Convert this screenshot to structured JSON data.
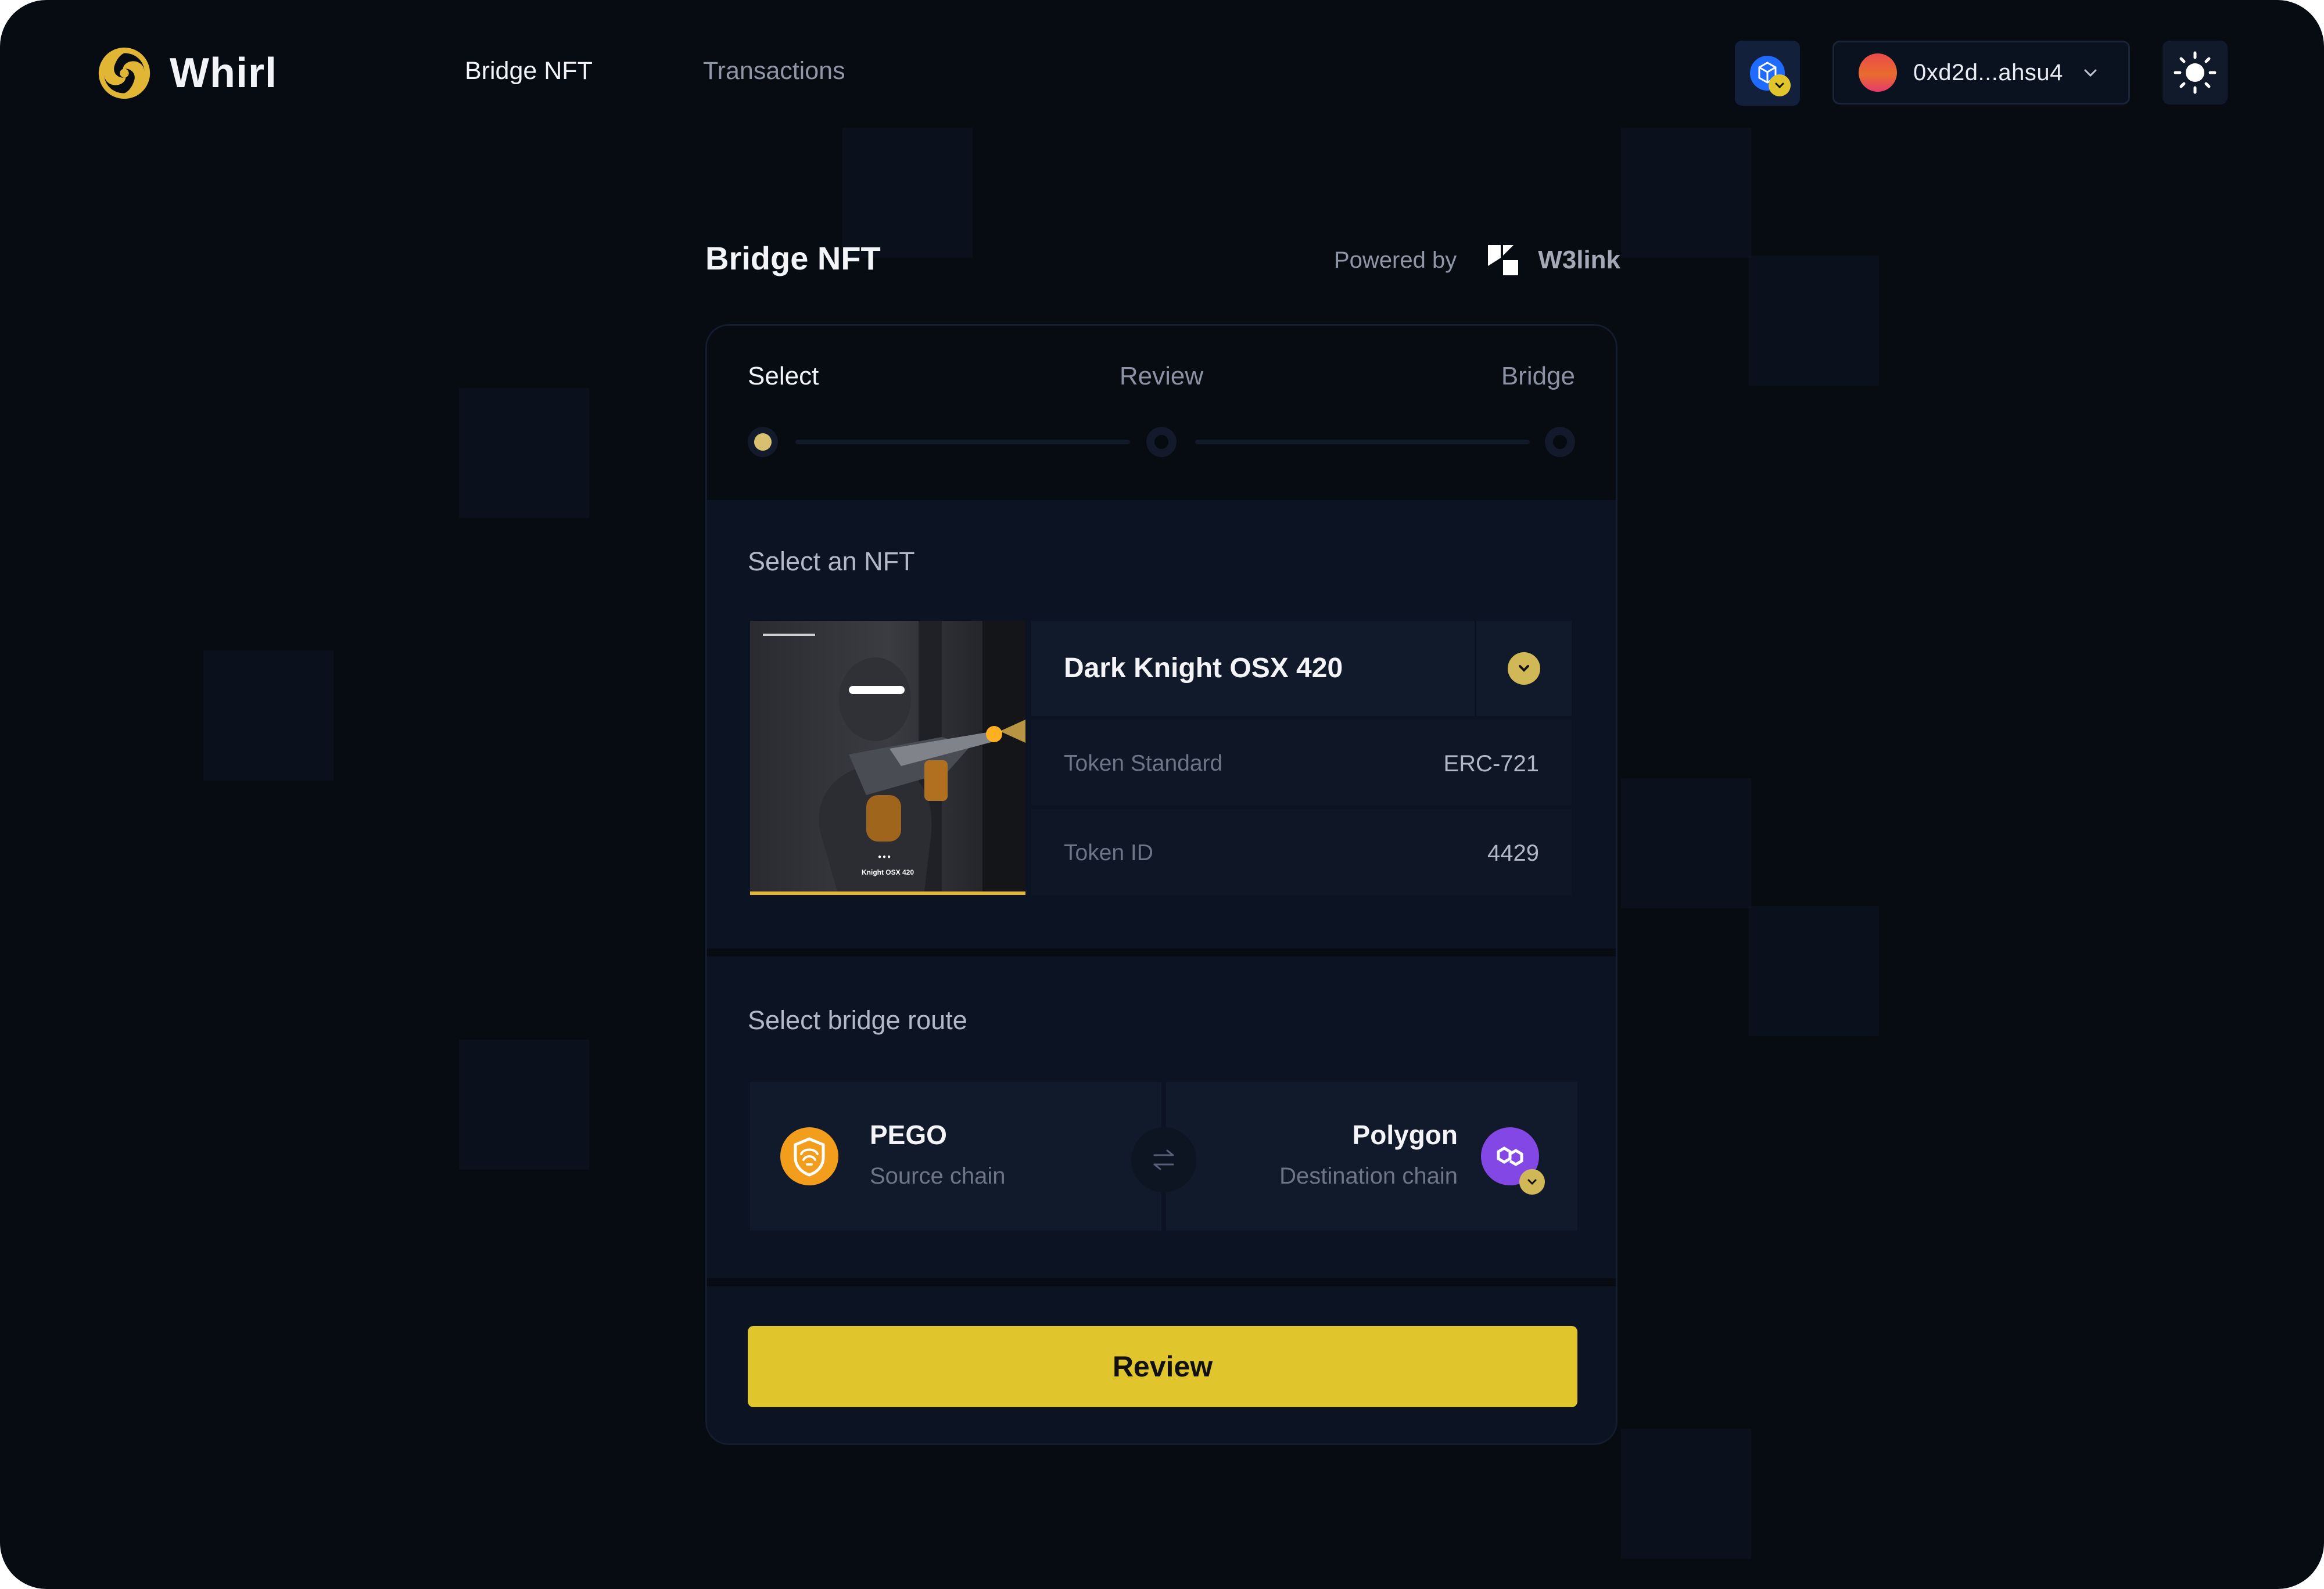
{
  "app": {
    "name": "Whirl",
    "accent_color": "#e0c52c",
    "background_color": "#070b12"
  },
  "nav": {
    "items": [
      {
        "label": "Bridge NFT",
        "active": true
      },
      {
        "label": "Transactions",
        "active": false
      }
    ]
  },
  "header": {
    "network_icon": "network-chain-icon",
    "wallet_address": "0xd2d...ahsu4",
    "theme_icon": "sun-icon"
  },
  "page": {
    "title": "Bridge NFT",
    "powered_by_label": "Powered by",
    "powered_by_brand": "W3link"
  },
  "stepper": {
    "steps": [
      {
        "label": "Select",
        "active": true
      },
      {
        "label": "Review",
        "active": false
      },
      {
        "label": "Bridge",
        "active": false
      }
    ]
  },
  "nft": {
    "section_label": "Select an NFT",
    "name": "Dark Knight OSX 420",
    "image_caption": "Knight OSX 420",
    "token_standard_label": "Token Standard",
    "token_standard": "ERC-721",
    "token_id_label": "Token ID",
    "token_id": "4429"
  },
  "route": {
    "section_label": "Select bridge route",
    "source": {
      "name": "PEGO",
      "label": "Source chain",
      "color": "#f29d1c"
    },
    "destination": {
      "name": "Polygon",
      "label": "Destination chain",
      "color": "#8247e5"
    }
  },
  "actions": {
    "review_label": "Review"
  }
}
